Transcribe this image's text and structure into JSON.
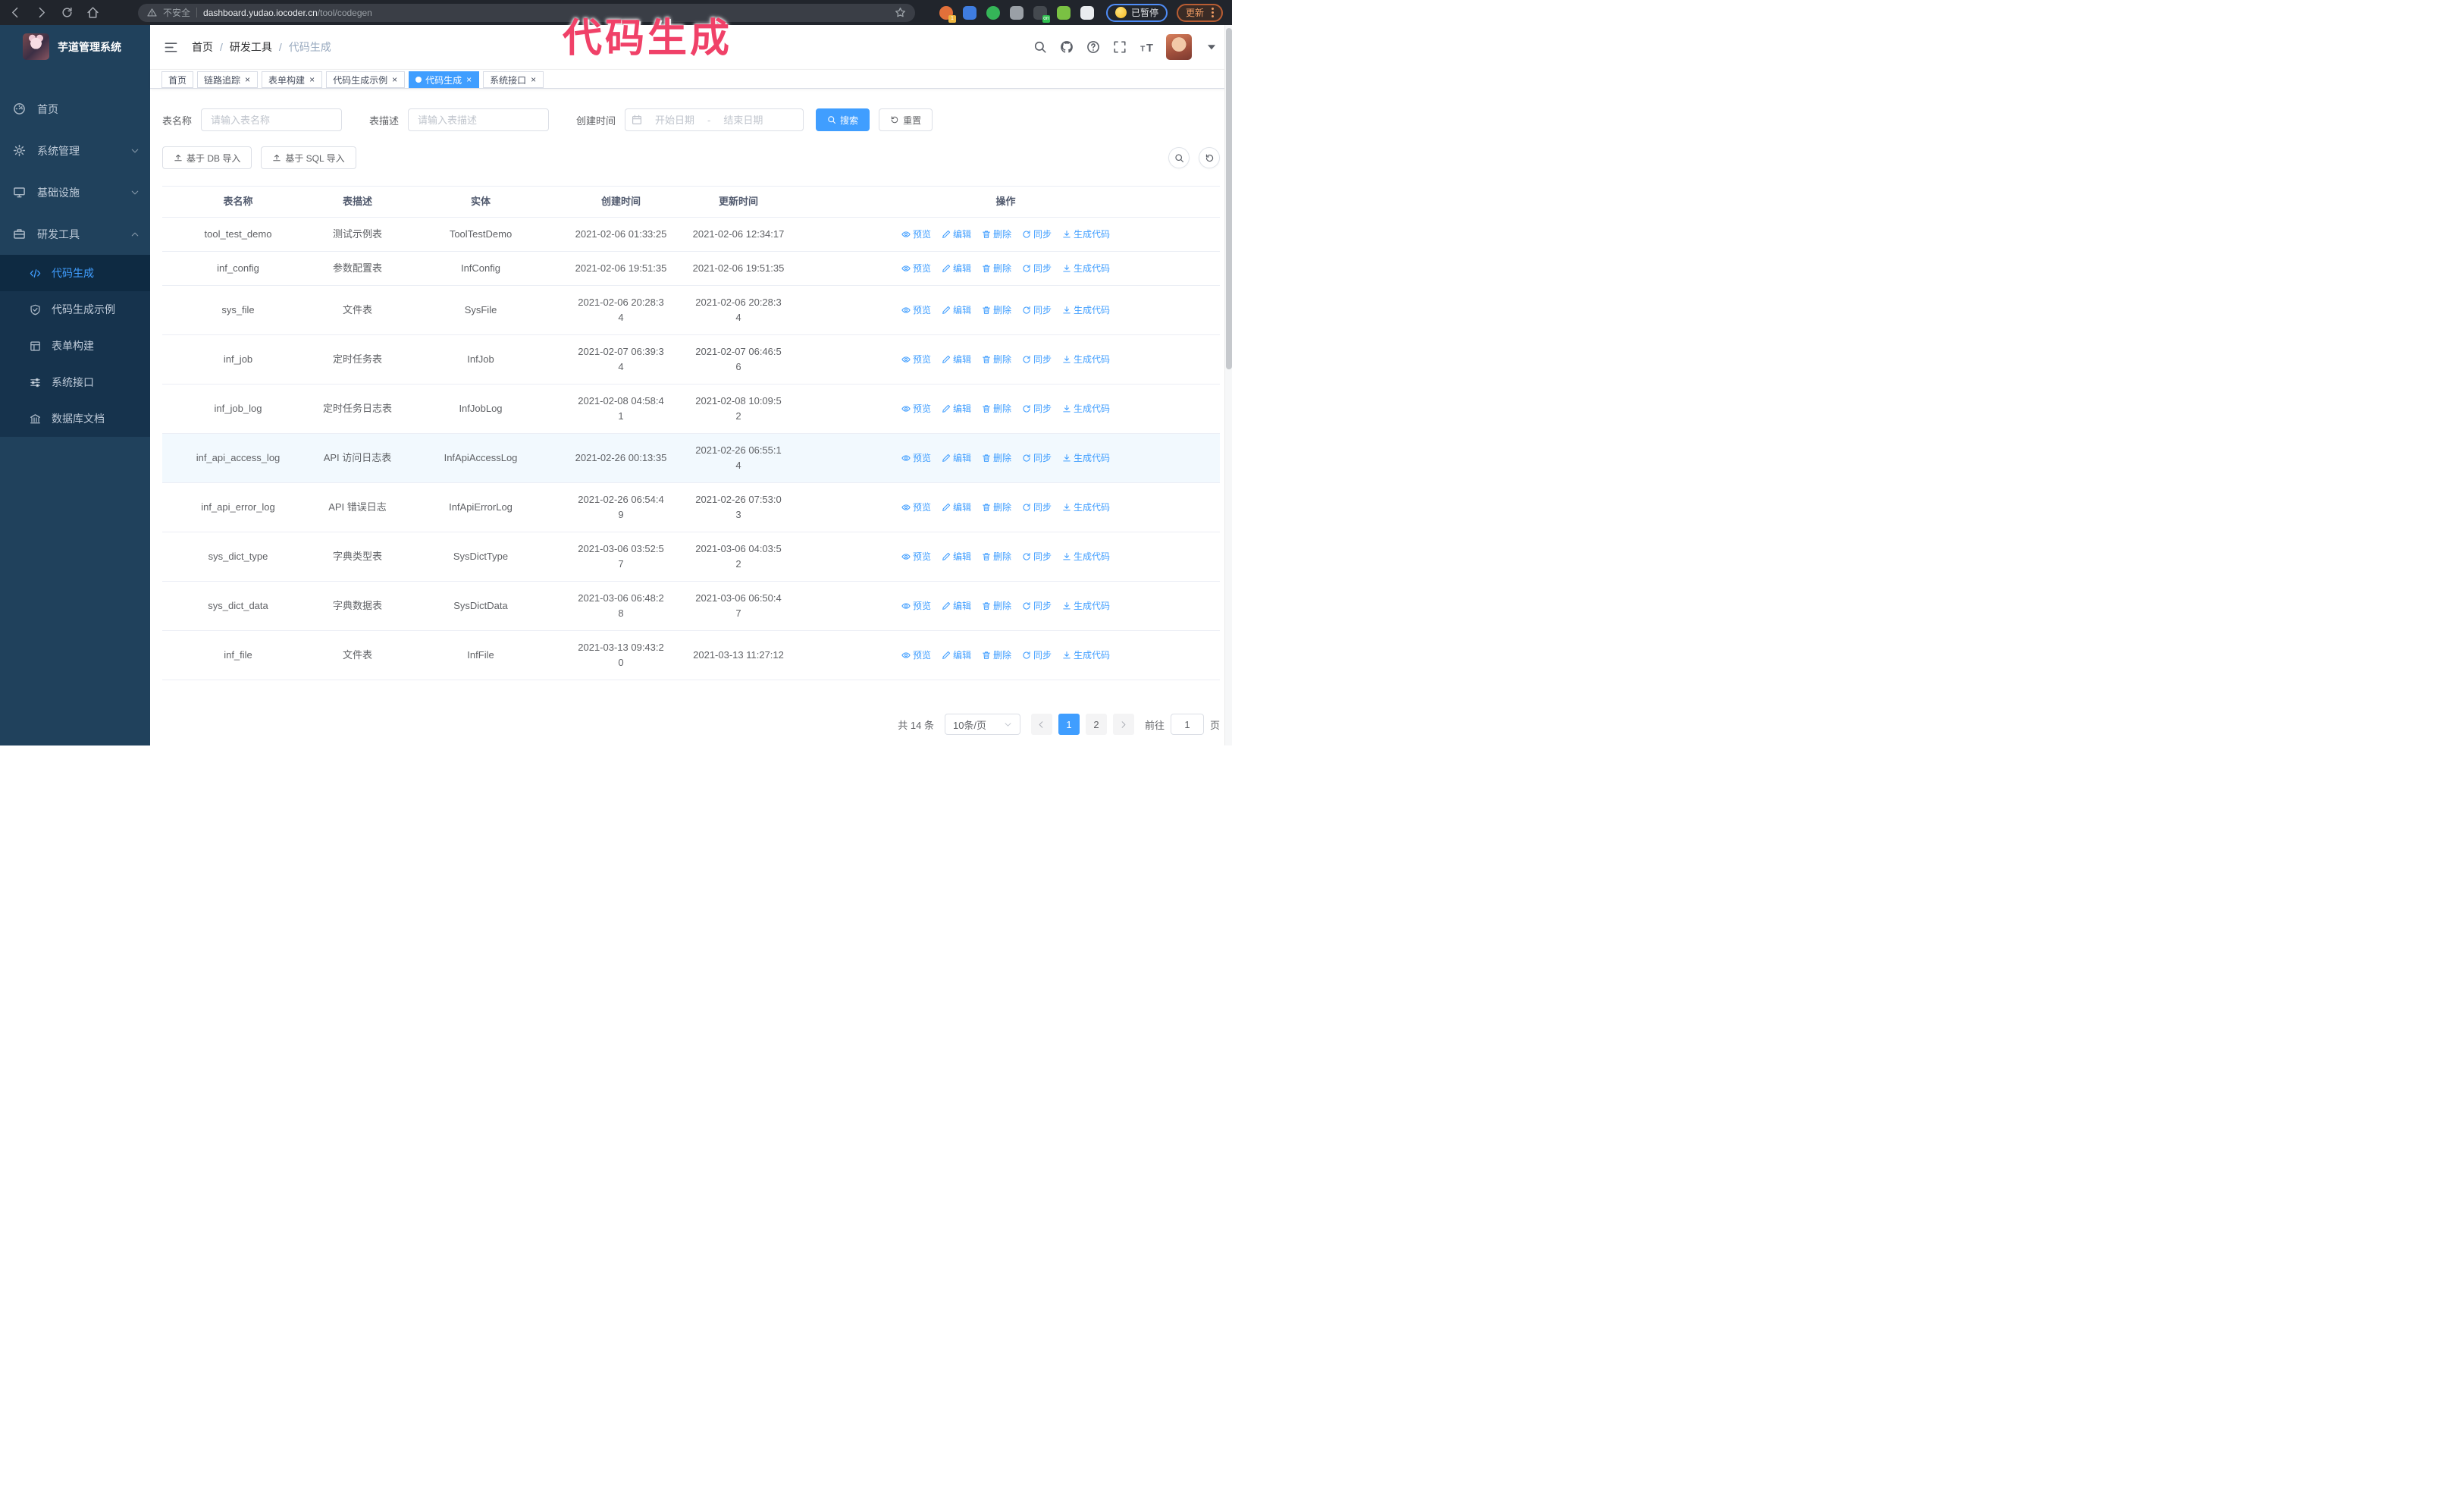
{
  "colors": {
    "accent": "#409eff",
    "annotation": "#f04168",
    "sidebar_bg": "#20415c",
    "submenu_bg": "#16334d"
  },
  "annotation": {
    "text": "代码生成"
  },
  "browser": {
    "security_label": "不安全",
    "url_host": "dashboard.yudao.iocoder.cn",
    "url_path": "/tool/codegen",
    "paused_label": "已暂停",
    "update_label": "更新",
    "extensions": [
      {
        "name": "extension-orange-circle",
        "color": "#e2703a",
        "badge": "1",
        "badge_color": "#f0b73f"
      },
      {
        "name": "extension-blue-gem",
        "color": "#3f7de0",
        "badge": "",
        "badge_color": ""
      },
      {
        "name": "extension-green-check",
        "color": "#35b558",
        "badge": "",
        "badge_color": ""
      },
      {
        "name": "extension-grid",
        "color": "#9aa0a6",
        "badge": "",
        "badge_color": "#39a7e8"
      },
      {
        "name": "extension-dark-on",
        "color": "#44494f",
        "badge": "on",
        "badge_color": "#2fbf4f"
      },
      {
        "name": "extension-green-figure",
        "color": "#7ac143",
        "badge": "",
        "badge_color": ""
      },
      {
        "name": "extension-white-ghost",
        "color": "#e9ecef",
        "badge": "",
        "badge_color": ""
      }
    ]
  },
  "sidebar": {
    "logo_title": "芋道管理系统",
    "items": [
      {
        "id": "home",
        "label": "首页",
        "icon": "dashboard-icon",
        "chevron": ""
      },
      {
        "id": "system",
        "label": "系统管理",
        "icon": "gear-icon",
        "chevron": "down"
      },
      {
        "id": "infra",
        "label": "基础设施",
        "icon": "monitor-icon",
        "chevron": "down"
      },
      {
        "id": "devtools",
        "label": "研发工具",
        "icon": "tools-icon",
        "chevron": "up",
        "children": [
          {
            "id": "codegen",
            "label": "代码生成",
            "icon": "code-icon",
            "active": true
          },
          {
            "id": "codegen-example",
            "label": "代码生成示例",
            "icon": "shield-check-icon",
            "active": false
          },
          {
            "id": "form-builder",
            "label": "表单构建",
            "icon": "form-icon",
            "active": false
          },
          {
            "id": "system-api",
            "label": "系统接口",
            "icon": "sliders-icon",
            "active": false
          },
          {
            "id": "db-doc",
            "label": "数据库文档",
            "icon": "columns-icon",
            "active": false
          }
        ]
      }
    ]
  },
  "header": {
    "breadcrumb": [
      "首页",
      "研发工具",
      "代码生成"
    ]
  },
  "tabs": [
    {
      "label": "首页",
      "closable": false,
      "active": false
    },
    {
      "label": "链路追踪",
      "closable": true,
      "active": false
    },
    {
      "label": "表单构建",
      "closable": true,
      "active": false
    },
    {
      "label": "代码生成示例",
      "closable": true,
      "active": false
    },
    {
      "label": "代码生成",
      "closable": true,
      "active": true
    },
    {
      "label": "系统接口",
      "closable": true,
      "active": false
    }
  ],
  "filters": {
    "table_name_label": "表名称",
    "table_name_placeholder": "请输入表名称",
    "table_desc_label": "表描述",
    "table_desc_placeholder": "请输入表描述",
    "create_time_label": "创建时间",
    "date_start_placeholder": "开始日期",
    "date_separator": "-",
    "date_end_placeholder": "结束日期",
    "search_label": "搜索",
    "reset_label": "重置"
  },
  "toolbar": {
    "import_db_label": "基于 DB 导入",
    "import_sql_label": "基于 SQL 导入"
  },
  "table": {
    "columns": [
      "表名称",
      "表描述",
      "实体",
      "创建时间",
      "更新时间",
      "操作"
    ],
    "actions": [
      {
        "label": "预览",
        "icon": "eye-icon"
      },
      {
        "label": "编辑",
        "icon": "edit-icon"
      },
      {
        "label": "删除",
        "icon": "trash-icon"
      },
      {
        "label": "同步",
        "icon": "sync-icon"
      },
      {
        "label": "生成代码",
        "icon": "download-icon"
      }
    ],
    "rows": [
      {
        "name": "tool_test_demo",
        "desc": "测试示例表",
        "entity": "ToolTestDemo",
        "created": "2021-02-06 01:33:25",
        "updated": "2021-02-06 12:34:17",
        "hover": false
      },
      {
        "name": "inf_config",
        "desc": "参数配置表",
        "entity": "InfConfig",
        "created": "2021-02-06 19:51:35",
        "updated": "2021-02-06 19:51:35",
        "hover": false
      },
      {
        "name": "sys_file",
        "desc": "文件表",
        "entity": "SysFile",
        "created": "2021-02-06 20:28:3\n4",
        "updated": "2021-02-06 20:28:3\n4",
        "hover": false
      },
      {
        "name": "inf_job",
        "desc": "定时任务表",
        "entity": "InfJob",
        "created": "2021-02-07 06:39:3\n4",
        "updated": "2021-02-07 06:46:5\n6",
        "hover": false
      },
      {
        "name": "inf_job_log",
        "desc": "定时任务日志表",
        "entity": "InfJobLog",
        "created": "2021-02-08 04:58:4\n1",
        "updated": "2021-02-08 10:09:5\n2",
        "hover": false
      },
      {
        "name": "inf_api_access_log",
        "desc": "API 访问日志表",
        "entity": "InfApiAccessLog",
        "created": "2021-02-26 00:13:35",
        "updated": "2021-02-26 06:55:1\n4",
        "hover": true
      },
      {
        "name": "inf_api_error_log",
        "desc": "API 错误日志",
        "entity": "InfApiErrorLog",
        "created": "2021-02-26 06:54:4\n9",
        "updated": "2021-02-26 07:53:0\n3",
        "hover": false
      },
      {
        "name": "sys_dict_type",
        "desc": "字典类型表",
        "entity": "SysDictType",
        "created": "2021-03-06 03:52:5\n7",
        "updated": "2021-03-06 04:03:5\n2",
        "hover": false
      },
      {
        "name": "sys_dict_data",
        "desc": "字典数据表",
        "entity": "SysDictData",
        "created": "2021-03-06 06:48:2\n8",
        "updated": "2021-03-06 06:50:4\n7",
        "hover": false
      },
      {
        "name": "inf_file",
        "desc": "文件表",
        "entity": "InfFile",
        "created": "2021-03-13 09:43:2\n0",
        "updated": "2021-03-13 11:27:12",
        "hover": false
      }
    ]
  },
  "pagination": {
    "total_label": "共 14 条",
    "page_size_label": "10条/页",
    "pages": [
      "1",
      "2"
    ],
    "active_page": "1",
    "goto_label": "前往",
    "goto_value": "1",
    "goto_suffix": "页"
  }
}
